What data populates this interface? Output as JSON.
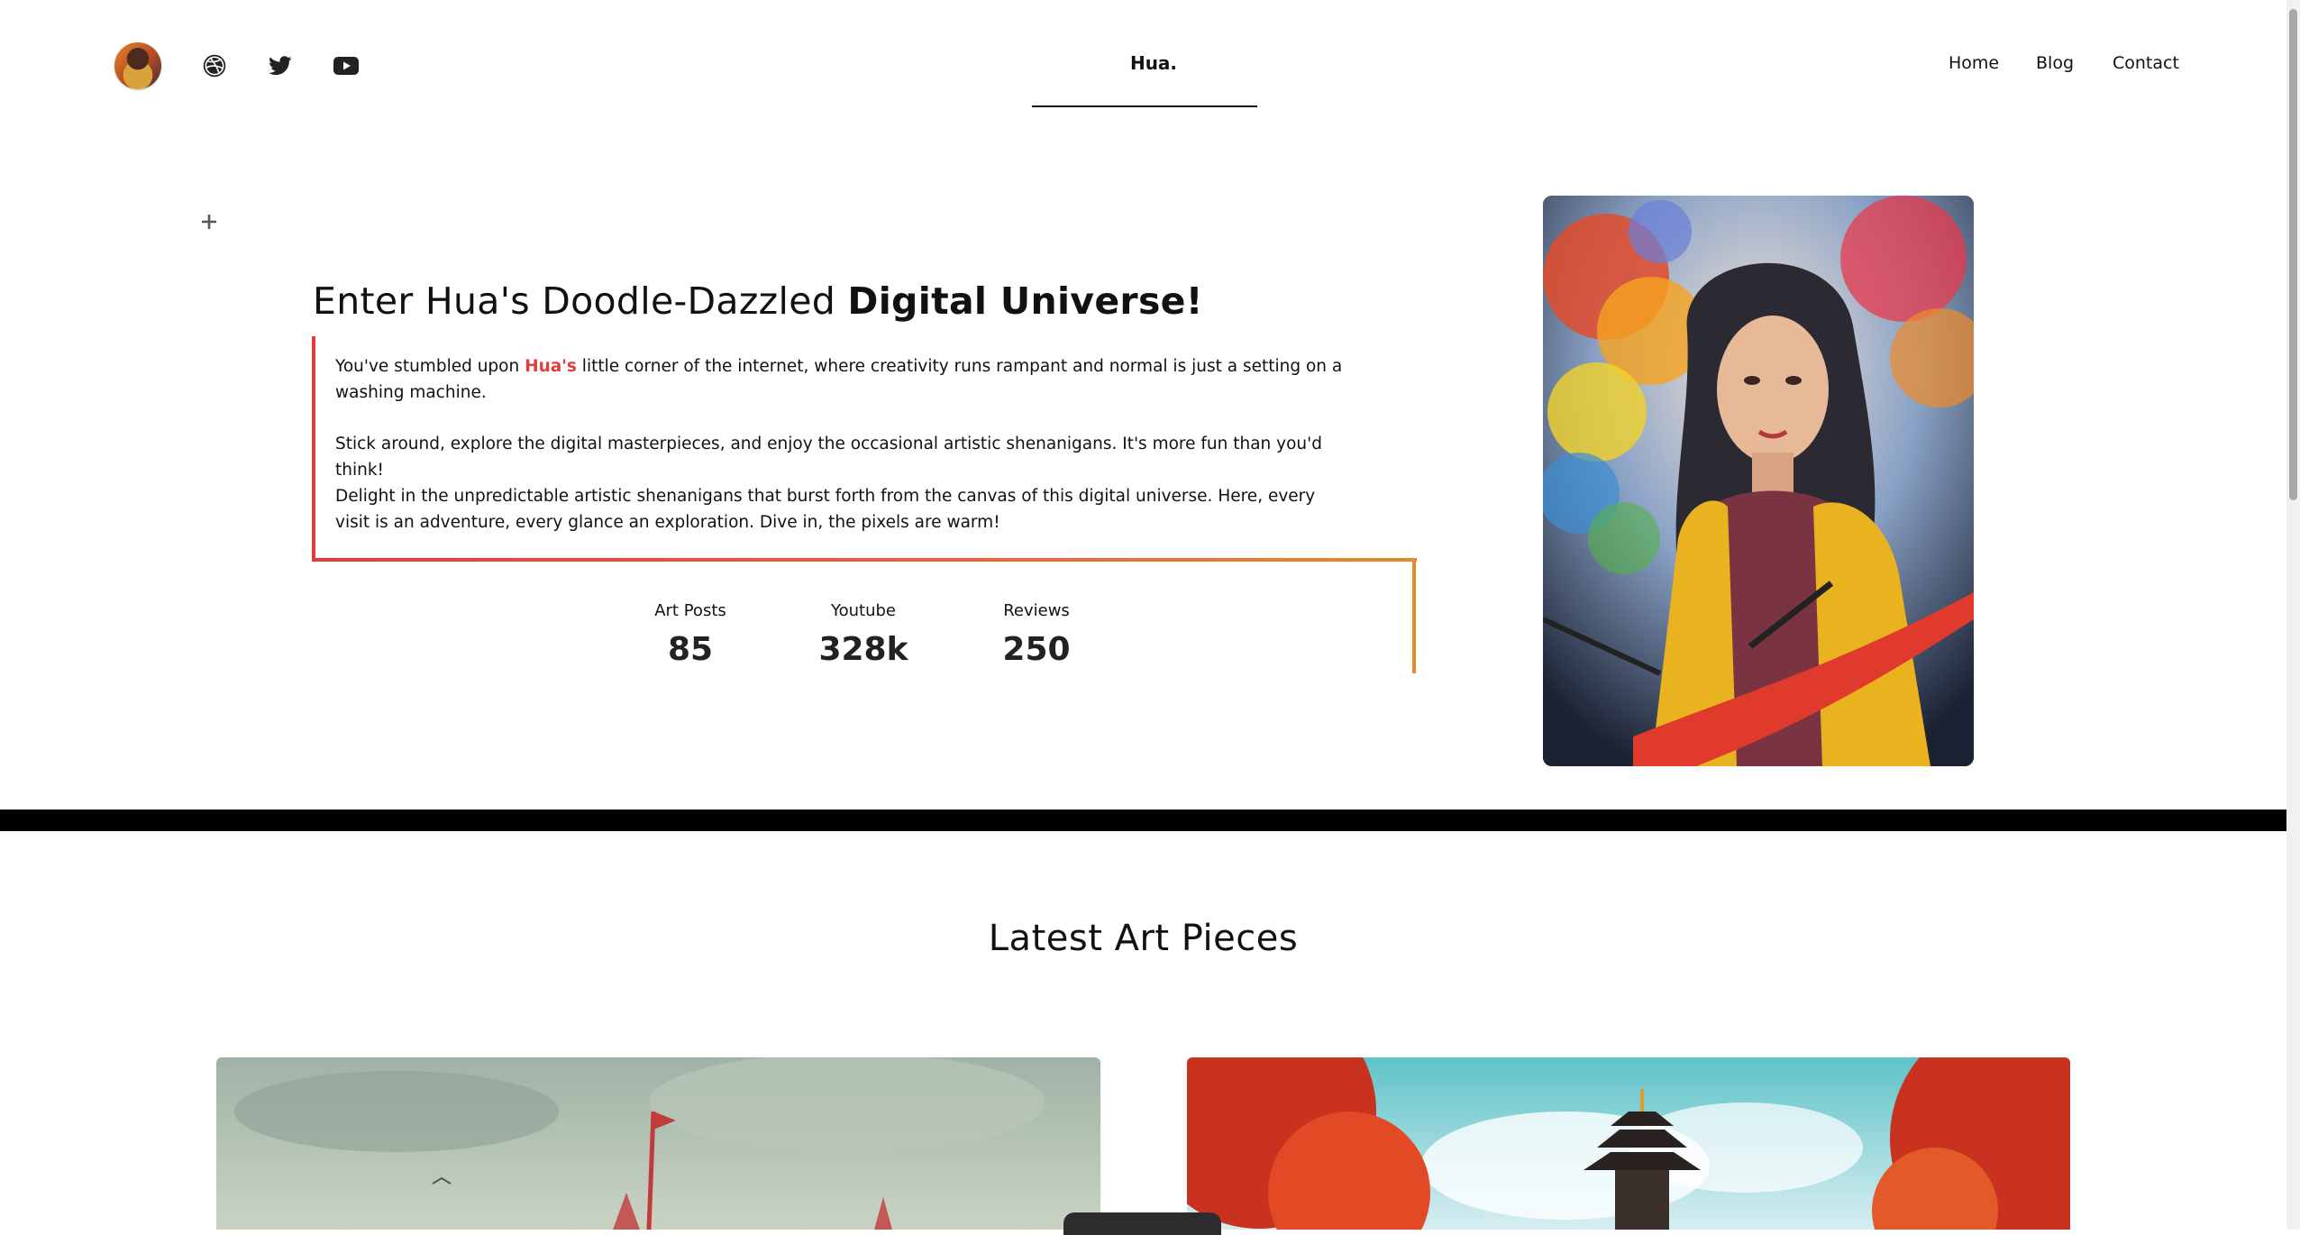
{
  "header": {
    "brand": "Hua.",
    "nav": [
      "Home",
      "Blog",
      "Contact"
    ],
    "social_icons": [
      "dribbble-icon",
      "twitter-icon",
      "youtube-icon"
    ]
  },
  "hero": {
    "title_regular": "Enter Hua's Doodle-Dazzled ",
    "title_bold": "Digital Universe!",
    "p1_before": "You've stumbled upon ",
    "p1_highlight": "Hua's",
    "p1_after": " little corner of the internet, where creativity runs rampant and normal is just a setting on a washing machine.",
    "p2": "Stick around, explore the digital masterpieces, and enjoy the occasional artistic shenanigans. It's more fun than you'd think!",
    "p3": "Delight in the unpredictable artistic shenanigans that burst forth from the canvas of this digital universe. Here, every visit is an adventure, every glance an exploration. Dive in, the pixels are warm!",
    "stats": [
      {
        "label": "Art Posts",
        "value": "85"
      },
      {
        "label": "Youtube",
        "value": "328k"
      },
      {
        "label": "Reviews",
        "value": "250"
      }
    ]
  },
  "section": {
    "title": "Latest Art Pieces"
  },
  "colors": {
    "accent": "#e23d3d",
    "accent_orange": "#e58a2a",
    "text": "#111111"
  }
}
